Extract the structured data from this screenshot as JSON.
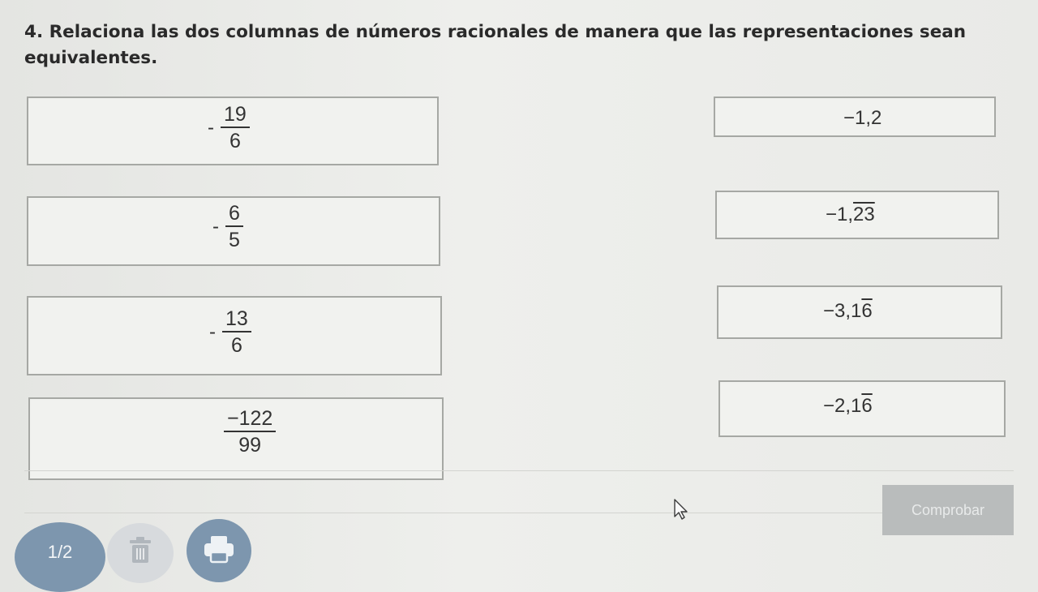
{
  "instruction": "4. Relaciona las dos columnas de números racionales de manera que las representaciones sean equivalentes.",
  "left_column": [
    {
      "sign": "-",
      "numerator": "19",
      "denominator": "6"
    },
    {
      "sign": "-",
      "numerator": "6",
      "denominator": "5"
    },
    {
      "sign": "-",
      "numerator": "13",
      "denominator": "6"
    },
    {
      "sign": "",
      "numerator": "−122",
      "denominator": "99"
    }
  ],
  "right_column": [
    {
      "integer": "−1,2",
      "period": ""
    },
    {
      "integer": "−1,",
      "period": "23"
    },
    {
      "integer": "−3,1",
      "period": "6"
    },
    {
      "integer": "−2,1",
      "period": "6"
    }
  ],
  "check_button": "Comprobar",
  "page_indicator": "1/2",
  "icons": {
    "trash": "trash-icon",
    "print": "printer-icon",
    "cursor": "mouse-cursor-icon"
  },
  "colors": {
    "box_border": "#a6a8a4",
    "button": "#b9bcbc",
    "page_badge": "#7d96ae"
  }
}
